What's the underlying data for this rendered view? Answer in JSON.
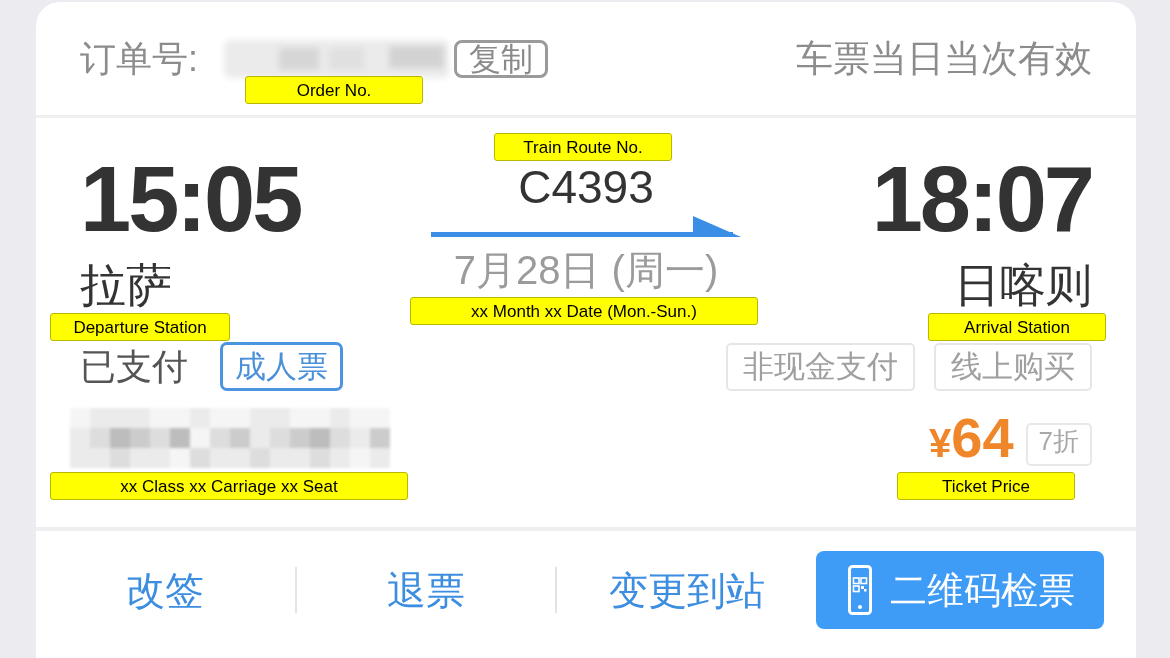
{
  "header": {
    "order_label": "订单号:",
    "order_number_blurred": true,
    "copy_button": "复制",
    "validity_note": "车票当日当次有效"
  },
  "departure": {
    "time": "15:05",
    "station": "拉萨"
  },
  "train": {
    "number": "C4393",
    "date": "7月28日 (周一)"
  },
  "arrival": {
    "time": "18:07",
    "station": "日喀则"
  },
  "payment_status": "已支付",
  "ticket_type": "成人票",
  "tags": [
    "非现金支付",
    "线上购买"
  ],
  "seat_info_blurred": true,
  "price": {
    "currency": "¥",
    "amount": "64",
    "discount": "7折"
  },
  "actions": [
    {
      "kind": "link",
      "label": "改签"
    },
    {
      "kind": "link",
      "label": "退票"
    },
    {
      "kind": "link",
      "label": "变更到站"
    },
    {
      "kind": "primary",
      "label": "二维码检票"
    }
  ],
  "annotations": [
    {
      "kind": "order_number",
      "text": "Order No."
    },
    {
      "kind": "train_number",
      "text": "Train Route No."
    },
    {
      "kind": "date",
      "text": "xx Month xx Date (Mon.-Sun.)"
    },
    {
      "kind": "departure_station",
      "text": "Departure Station"
    },
    {
      "kind": "arrival_station",
      "text": "Arrival Station"
    },
    {
      "kind": "seat",
      "text": "xx Class xx Carriage xx Seat"
    },
    {
      "kind": "price",
      "text": "Ticket Price"
    }
  ]
}
